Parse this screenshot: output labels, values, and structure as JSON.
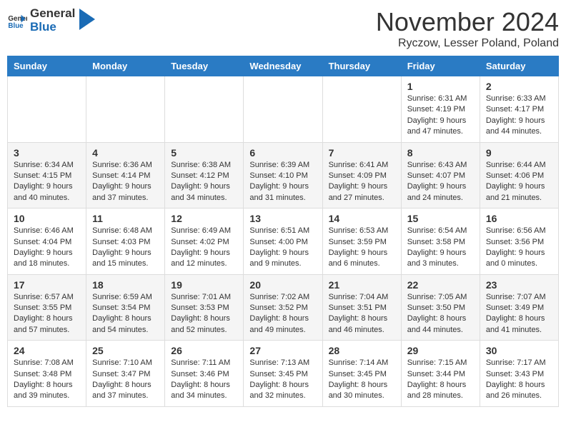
{
  "header": {
    "logo_general": "General",
    "logo_blue": "Blue",
    "month_year": "November 2024",
    "location": "Ryczow, Lesser Poland, Poland"
  },
  "days_of_week": [
    "Sunday",
    "Monday",
    "Tuesday",
    "Wednesday",
    "Thursday",
    "Friday",
    "Saturday"
  ],
  "weeks": [
    [
      {
        "day": "",
        "info": ""
      },
      {
        "day": "",
        "info": ""
      },
      {
        "day": "",
        "info": ""
      },
      {
        "day": "",
        "info": ""
      },
      {
        "day": "",
        "info": ""
      },
      {
        "day": "1",
        "info": "Sunrise: 6:31 AM\nSunset: 4:19 PM\nDaylight: 9 hours and 47 minutes."
      },
      {
        "day": "2",
        "info": "Sunrise: 6:33 AM\nSunset: 4:17 PM\nDaylight: 9 hours and 44 minutes."
      }
    ],
    [
      {
        "day": "3",
        "info": "Sunrise: 6:34 AM\nSunset: 4:15 PM\nDaylight: 9 hours and 40 minutes."
      },
      {
        "day": "4",
        "info": "Sunrise: 6:36 AM\nSunset: 4:14 PM\nDaylight: 9 hours and 37 minutes."
      },
      {
        "day": "5",
        "info": "Sunrise: 6:38 AM\nSunset: 4:12 PM\nDaylight: 9 hours and 34 minutes."
      },
      {
        "day": "6",
        "info": "Sunrise: 6:39 AM\nSunset: 4:10 PM\nDaylight: 9 hours and 31 minutes."
      },
      {
        "day": "7",
        "info": "Sunrise: 6:41 AM\nSunset: 4:09 PM\nDaylight: 9 hours and 27 minutes."
      },
      {
        "day": "8",
        "info": "Sunrise: 6:43 AM\nSunset: 4:07 PM\nDaylight: 9 hours and 24 minutes."
      },
      {
        "day": "9",
        "info": "Sunrise: 6:44 AM\nSunset: 4:06 PM\nDaylight: 9 hours and 21 minutes."
      }
    ],
    [
      {
        "day": "10",
        "info": "Sunrise: 6:46 AM\nSunset: 4:04 PM\nDaylight: 9 hours and 18 minutes."
      },
      {
        "day": "11",
        "info": "Sunrise: 6:48 AM\nSunset: 4:03 PM\nDaylight: 9 hours and 15 minutes."
      },
      {
        "day": "12",
        "info": "Sunrise: 6:49 AM\nSunset: 4:02 PM\nDaylight: 9 hours and 12 minutes."
      },
      {
        "day": "13",
        "info": "Sunrise: 6:51 AM\nSunset: 4:00 PM\nDaylight: 9 hours and 9 minutes."
      },
      {
        "day": "14",
        "info": "Sunrise: 6:53 AM\nSunset: 3:59 PM\nDaylight: 9 hours and 6 minutes."
      },
      {
        "day": "15",
        "info": "Sunrise: 6:54 AM\nSunset: 3:58 PM\nDaylight: 9 hours and 3 minutes."
      },
      {
        "day": "16",
        "info": "Sunrise: 6:56 AM\nSunset: 3:56 PM\nDaylight: 9 hours and 0 minutes."
      }
    ],
    [
      {
        "day": "17",
        "info": "Sunrise: 6:57 AM\nSunset: 3:55 PM\nDaylight: 8 hours and 57 minutes."
      },
      {
        "day": "18",
        "info": "Sunrise: 6:59 AM\nSunset: 3:54 PM\nDaylight: 8 hours and 54 minutes."
      },
      {
        "day": "19",
        "info": "Sunrise: 7:01 AM\nSunset: 3:53 PM\nDaylight: 8 hours and 52 minutes."
      },
      {
        "day": "20",
        "info": "Sunrise: 7:02 AM\nSunset: 3:52 PM\nDaylight: 8 hours and 49 minutes."
      },
      {
        "day": "21",
        "info": "Sunrise: 7:04 AM\nSunset: 3:51 PM\nDaylight: 8 hours and 46 minutes."
      },
      {
        "day": "22",
        "info": "Sunrise: 7:05 AM\nSunset: 3:50 PM\nDaylight: 8 hours and 44 minutes."
      },
      {
        "day": "23",
        "info": "Sunrise: 7:07 AM\nSunset: 3:49 PM\nDaylight: 8 hours and 41 minutes."
      }
    ],
    [
      {
        "day": "24",
        "info": "Sunrise: 7:08 AM\nSunset: 3:48 PM\nDaylight: 8 hours and 39 minutes."
      },
      {
        "day": "25",
        "info": "Sunrise: 7:10 AM\nSunset: 3:47 PM\nDaylight: 8 hours and 37 minutes."
      },
      {
        "day": "26",
        "info": "Sunrise: 7:11 AM\nSunset: 3:46 PM\nDaylight: 8 hours and 34 minutes."
      },
      {
        "day": "27",
        "info": "Sunrise: 7:13 AM\nSunset: 3:45 PM\nDaylight: 8 hours and 32 minutes."
      },
      {
        "day": "28",
        "info": "Sunrise: 7:14 AM\nSunset: 3:45 PM\nDaylight: 8 hours and 30 minutes."
      },
      {
        "day": "29",
        "info": "Sunrise: 7:15 AM\nSunset: 3:44 PM\nDaylight: 8 hours and 28 minutes."
      },
      {
        "day": "30",
        "info": "Sunrise: 7:17 AM\nSunset: 3:43 PM\nDaylight: 8 hours and 26 minutes."
      }
    ]
  ]
}
